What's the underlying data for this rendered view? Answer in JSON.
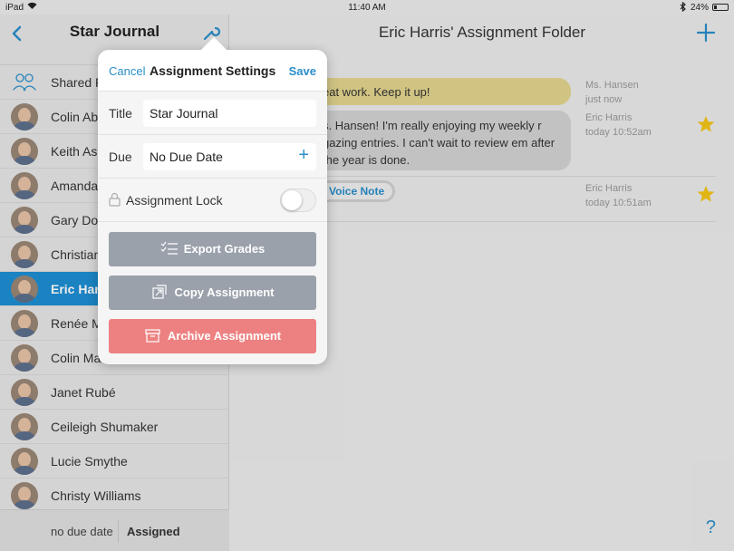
{
  "status_bar": {
    "carrier": "iPad",
    "time": "11:40 AM",
    "battery": "24%"
  },
  "sidebar": {
    "title": "Star Journal",
    "items": [
      {
        "label": "Shared F"
      },
      {
        "label": "Colin Ab"
      },
      {
        "label": "Keith Ash"
      },
      {
        "label": "Amanda"
      },
      {
        "label": "Gary Dor"
      },
      {
        "label": "Christian"
      },
      {
        "label": "Eric Harr"
      },
      {
        "label": "Renée M"
      },
      {
        "label": "Colin Ma"
      },
      {
        "label": "Janet Rubé"
      },
      {
        "label": "Ceileigh Shumaker"
      },
      {
        "label": "Lucie Smythe"
      },
      {
        "label": "Christy Williams"
      }
    ],
    "selected_index": 6,
    "footer": {
      "left": "no due date",
      "right": "Assigned"
    }
  },
  "main": {
    "title": "Eric Harris' Assignment Folder",
    "comments": [
      {
        "text": "eat work. Keep it up!",
        "author": "Ms. Hansen",
        "time": "just now"
      },
      {
        "text": "s. Hansen! I'm really enjoying my weekly r gazing entries. I can't wait to review em after the year is done.",
        "author": "Eric Harris",
        "time": "today 10:52am"
      },
      {
        "text": "Voice Note",
        "author": "Eric Harris",
        "time": "today 10:51am"
      }
    ]
  },
  "popover": {
    "cancel": "Cancel",
    "title": "Assignment Settings",
    "save": "Save",
    "title_label": "Title",
    "title_value": "Star Journal",
    "due_label": "Due",
    "due_value": "No Due Date",
    "lock_label": "Assignment Lock",
    "export": "Export Grades",
    "copy": "Copy Assignment",
    "archive": "Archive Assignment"
  },
  "colors": {
    "accent": "#2a8ec9",
    "selected": "#1e8fd3",
    "star": "#f5c518",
    "archive": "#ed8182"
  }
}
